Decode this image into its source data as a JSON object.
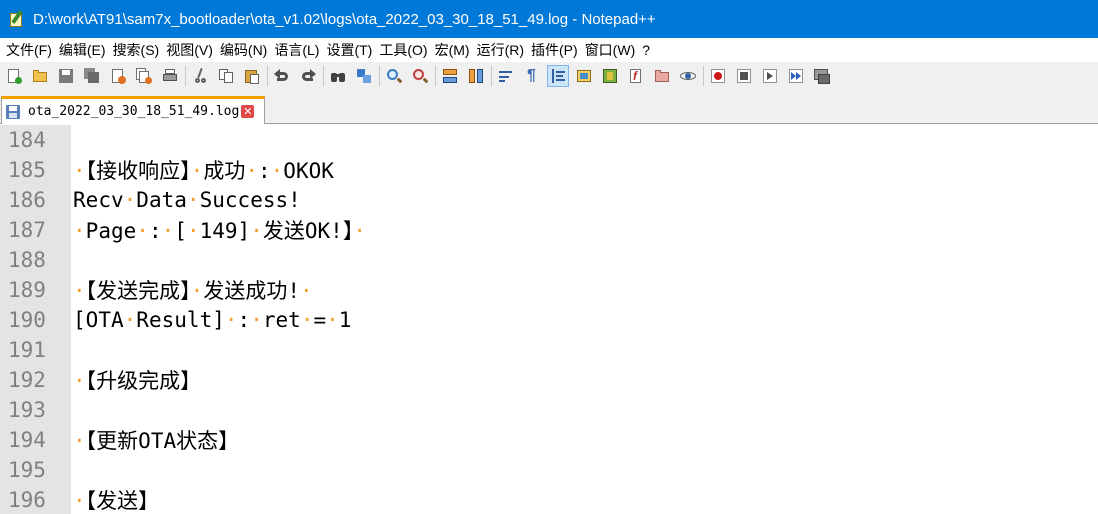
{
  "window": {
    "title": "D:\\work\\AT91\\sam7x_bootloader\\ota_v1.02\\logs\\ota_2022_03_30_18_51_49.log - Notepad++"
  },
  "menu": [
    "文件(F)",
    "编辑(E)",
    "搜索(S)",
    "视图(V)",
    "编码(N)",
    "语言(L)",
    "设置(T)",
    "工具(O)",
    "宏(M)",
    "运行(R)",
    "插件(P)",
    "窗口(W)",
    "?"
  ],
  "tab": {
    "label": "ota_2022_03_30_18_51_49.log",
    "close": "✕"
  },
  "editor": {
    "lines": [
      {
        "num": "184",
        "text": ""
      },
      {
        "num": "185",
        "text": "·【接收响应】·成功·:·OKOK"
      },
      {
        "num": "186",
        "text": "Recv·Data·Success!"
      },
      {
        "num": "187",
        "text": "·Page·:·[·149]·发送OK!】·"
      },
      {
        "num": "188",
        "text": ""
      },
      {
        "num": "189",
        "text": "·【发送完成】·发送成功!·"
      },
      {
        "num": "190",
        "text": "[OTA·Result]·:·ret·=·1"
      },
      {
        "num": "191",
        "text": ""
      },
      {
        "num": "192",
        "text": "·【升级完成】"
      },
      {
        "num": "193",
        "text": ""
      },
      {
        "num": "194",
        "text": "·【更新OTA状态】"
      },
      {
        "num": "195",
        "text": ""
      },
      {
        "num": "196",
        "text": "·【发送】"
      }
    ]
  },
  "colors": {
    "titlebar": "#0078d7",
    "gutter": "#e4e4e4",
    "line_number": "#808080",
    "tab_accent": "#f5a000",
    "whitespace_dot": "#f0a030"
  }
}
